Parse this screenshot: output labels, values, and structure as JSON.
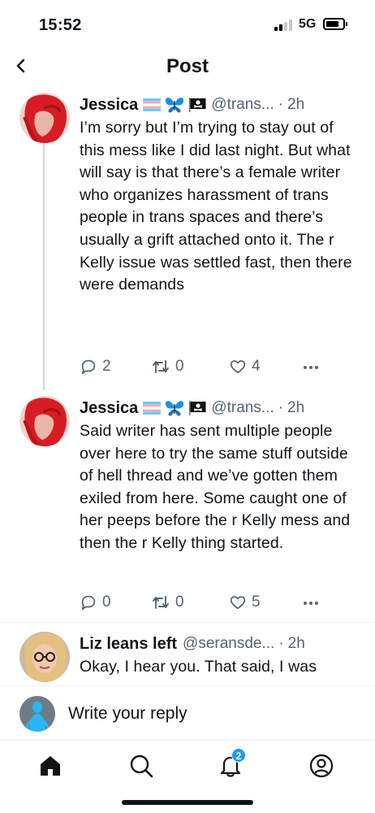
{
  "status_bar": {
    "time": "15:52",
    "network": "5G"
  },
  "nav": {
    "title": "Post"
  },
  "tweets": [
    {
      "name": "Jessica",
      "flags": [
        "trans-flag",
        "blue-butterfly",
        "pirate-flag"
      ],
      "handle": "@trans...",
      "separator": "·",
      "time": "2h",
      "text": "I’m sorry but I’m trying to stay out of this mess like I did last night. But what will say is that there’s a female writer who organizes harassment of trans people in trans spaces and there’s usually a grift attached onto it. The r Kelly issue was settled fast, then there were demands",
      "replies": "2",
      "reposts": "0",
      "likes": "4"
    },
    {
      "name": "Jessica",
      "flags": [
        "trans-flag",
        "blue-butterfly",
        "pirate-flag"
      ],
      "handle": "@trans...",
      "separator": "·",
      "time": "2h",
      "text": "Said writer has sent multiple people over here to try the same stuff outside of hell thread and we’ve gotten them exiled from here. Some caught one of her peeps before the r Kelly mess and then the r Kelly thing started.",
      "replies": "0",
      "reposts": "0",
      "likes": "5"
    },
    {
      "name": "Liz leans left",
      "handle": "@seransde...",
      "separator": "·",
      "time": "2h",
      "text": "Okay, I hear you. That said, I was"
    }
  ],
  "reply_bar": {
    "placeholder": "Write your reply"
  },
  "tab_bar": {
    "notifications_badge": "2"
  },
  "icons": {
    "back": "chevron-left-icon",
    "reply": "comment-icon",
    "repost": "repost-icon",
    "like": "heart-icon",
    "more": "ellipsis-icon",
    "home": "home-icon",
    "search": "search-icon",
    "notifications": "bell-icon",
    "profile": "profile-icon"
  },
  "colors": {
    "accent": "#1d9bf0",
    "text": "#0f1419",
    "muted": "#536471"
  }
}
